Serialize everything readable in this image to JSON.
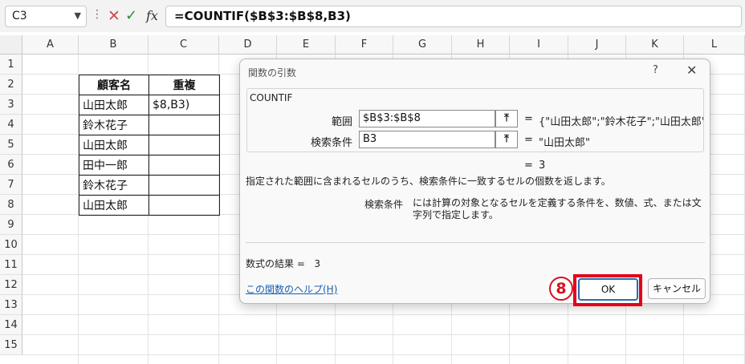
{
  "formula_bar": {
    "name_box": "C3",
    "formula": "=COUNTIF($B$3:$B$8,B3)",
    "cancel_icon": "close-icon",
    "enter_icon": "check-icon",
    "fx_label": "fx"
  },
  "columns": [
    "A",
    "B",
    "C",
    "D",
    "E",
    "F",
    "G",
    "H",
    "I",
    "J",
    "K",
    "L"
  ],
  "rows": [
    "1",
    "2",
    "3",
    "4",
    "5",
    "6",
    "7",
    "8",
    "9",
    "10",
    "11",
    "12",
    "13",
    "14",
    "15"
  ],
  "table": {
    "headers": [
      "顧客名",
      "重複"
    ],
    "rows": [
      {
        "name": "山田太郎",
        "dup": "$8,B3)"
      },
      {
        "name": "鈴木花子",
        "dup": ""
      },
      {
        "name": "山田太郎",
        "dup": ""
      },
      {
        "name": "田中一郎",
        "dup": ""
      },
      {
        "name": "鈴木花子",
        "dup": ""
      },
      {
        "name": "山田太郎",
        "dup": ""
      }
    ]
  },
  "dialog": {
    "title": "関数の引数",
    "help_glyph": "?",
    "function_name": "COUNTIF",
    "args": [
      {
        "label": "範囲",
        "value": "$B$3:$B$8",
        "result": "{\"山田太郎\";\"鈴木花子\";\"山田太郎\";'"
      },
      {
        "label": "検索条件",
        "value": "B3",
        "result": "\"山田太郎\""
      }
    ],
    "equals": "=",
    "result": "3",
    "description": "指定された範囲に含まれるセルのうち、検索条件に一致するセルの個数を返します。",
    "arg_desc_name": "検索条件",
    "arg_desc_text": "には計算の対象となるセルを定義する条件を、数値、式、または文字列で指定します。",
    "formula_result_label": "数式の結果 =",
    "formula_result_value": "3",
    "help_link": "この関数のヘルプ(H)",
    "ok_label": "OK",
    "cancel_label": "キャンセル",
    "step_marker": "8"
  },
  "colors": {
    "accent": "#2b6cb0",
    "highlight": "#e3001b",
    "link": "#1a5fb4"
  }
}
